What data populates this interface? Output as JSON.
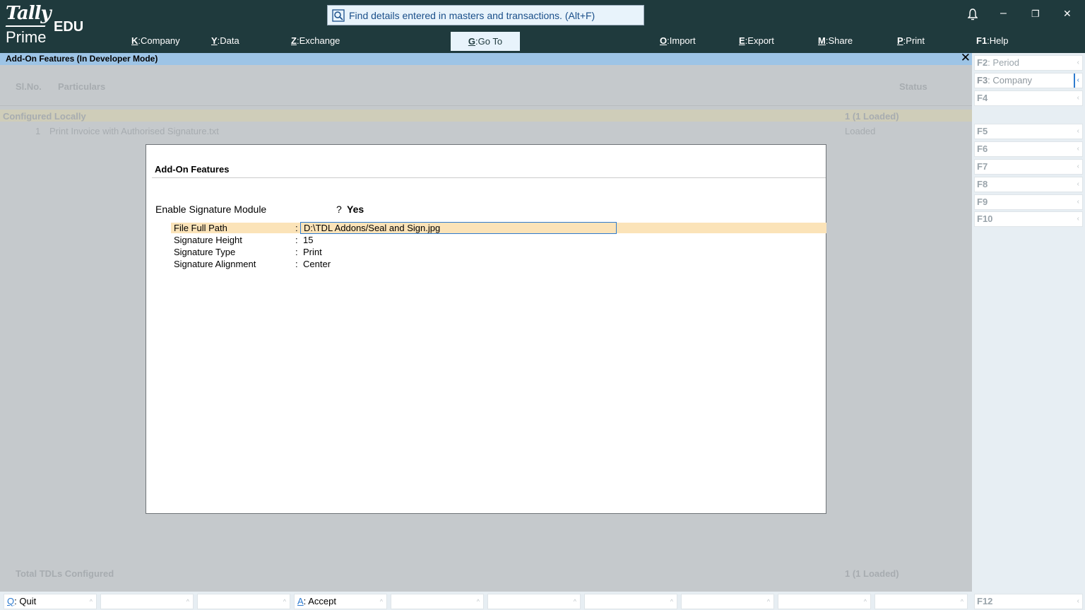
{
  "app": {
    "logo_tally": "Tally",
    "logo_prime": "Prime",
    "logo_edu": "EDU",
    "search_placeholder": "Find details entered in masters and transactions. (Alt+F)"
  },
  "menu": [
    {
      "key": "K",
      "label": "Company"
    },
    {
      "key": "Y",
      "label": "Data"
    },
    {
      "key": "Z",
      "label": "Exchange"
    },
    {
      "key": "G",
      "label": "Go To"
    },
    {
      "key": "O",
      "label": "Import"
    },
    {
      "key": "E",
      "label": "Export"
    },
    {
      "key": "M",
      "label": "Share"
    },
    {
      "key": "P",
      "label": "Print"
    },
    {
      "key": "F1",
      "label": "Help"
    }
  ],
  "window_controls": {
    "bell": "bell-icon",
    "minimize": "–",
    "restore": "❐",
    "close": "✕"
  },
  "title": "Add-On Features (In Developer Mode)",
  "report": {
    "columns": {
      "slno": "Sl.No.",
      "particulars": "Particulars",
      "status": "Status"
    },
    "group": {
      "label": "Configured Locally",
      "status": "1 (1 Loaded)"
    },
    "rows": [
      {
        "num": "1",
        "name": "Print Invoice with Authorised Signature.txt",
        "status": "Loaded"
      }
    ],
    "total": {
      "label": "Total TDLs Configured",
      "status": "1 (1 Loaded)"
    }
  },
  "dialog": {
    "title": "Add-On Features",
    "enable": {
      "label": "Enable Signature Module",
      "q": "?",
      "value": "Yes"
    },
    "fields": [
      {
        "label": "File Full Path",
        "value": "D:\\TDL Addons/Seal and Sign.jpg"
      },
      {
        "label": "Signature Height",
        "value": "15"
      },
      {
        "label": "Signature Type",
        "value": "Print"
      },
      {
        "label": "Signature Alignment",
        "value": "Center"
      }
    ]
  },
  "side_buttons": [
    {
      "key": "F2",
      "label": "Period"
    },
    {
      "key": "F3",
      "label": "Company"
    },
    {
      "key": "F4",
      "label": ""
    },
    {
      "key": "F5",
      "label": ""
    },
    {
      "key": "F6",
      "label": ""
    },
    {
      "key": "F7",
      "label": ""
    },
    {
      "key": "F8",
      "label": ""
    },
    {
      "key": "F9",
      "label": ""
    },
    {
      "key": "F10",
      "label": ""
    },
    {
      "key": "F12",
      "label": ""
    }
  ],
  "bottom_buttons": [
    {
      "key": "Q",
      "label": "Quit"
    },
    {
      "key": "A",
      "label": "Accept"
    }
  ],
  "colors": {
    "topbar": "#1f3a3d",
    "titlebar": "#9dc4e6",
    "highlight": "#fbe3b8",
    "accent": "#2e7bcf"
  }
}
